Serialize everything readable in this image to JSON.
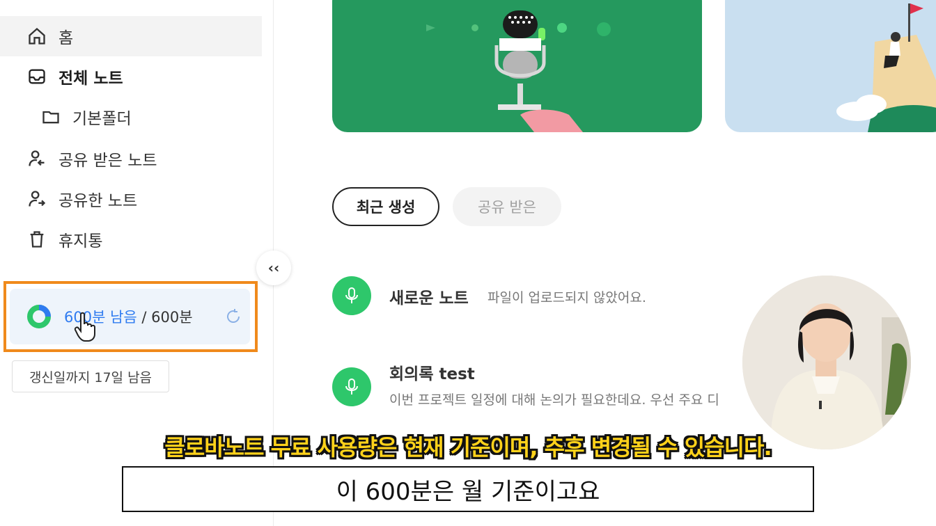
{
  "sidebar": {
    "items": [
      {
        "label": "홈",
        "icon": "home-icon"
      },
      {
        "label": "전체 노트",
        "icon": "inbox-icon"
      },
      {
        "label": "기본폴더",
        "icon": "folder-icon"
      },
      {
        "label": "공유 받은 노트",
        "icon": "user-received-icon"
      },
      {
        "label": "공유한 노트",
        "icon": "user-shared-icon"
      },
      {
        "label": "휴지통",
        "icon": "trash-icon"
      }
    ],
    "usage": {
      "remaining": "600분 남음",
      "total": " / 600분",
      "remaining_fraction": 1.0
    },
    "renew_text": "갱신일까지 17일 남음",
    "collapse_label": "‹‹"
  },
  "tabs": [
    {
      "label": "최근 생성"
    },
    {
      "label": "공유 받은"
    }
  ],
  "notes": [
    {
      "title": "새로운 노트",
      "desc": "파일이 업로드되지 않았어요."
    },
    {
      "title": "회의록 test",
      "desc": "이번 프로젝트 일정에 대해 논의가 필요한데요. 우선 주요 디"
    }
  ],
  "subtitles": {
    "caption": "클로바노트 무료 사용량은 현재 기준이며, 추후 변경될 수 있습니다.",
    "speech": "이 600분은 월 기준이고요"
  },
  "colors": {
    "accent_green": "#25995e",
    "mic_green": "#2ec76b",
    "usage_blue": "#2f7bf0",
    "highlight_orange": "#f08a1c"
  }
}
